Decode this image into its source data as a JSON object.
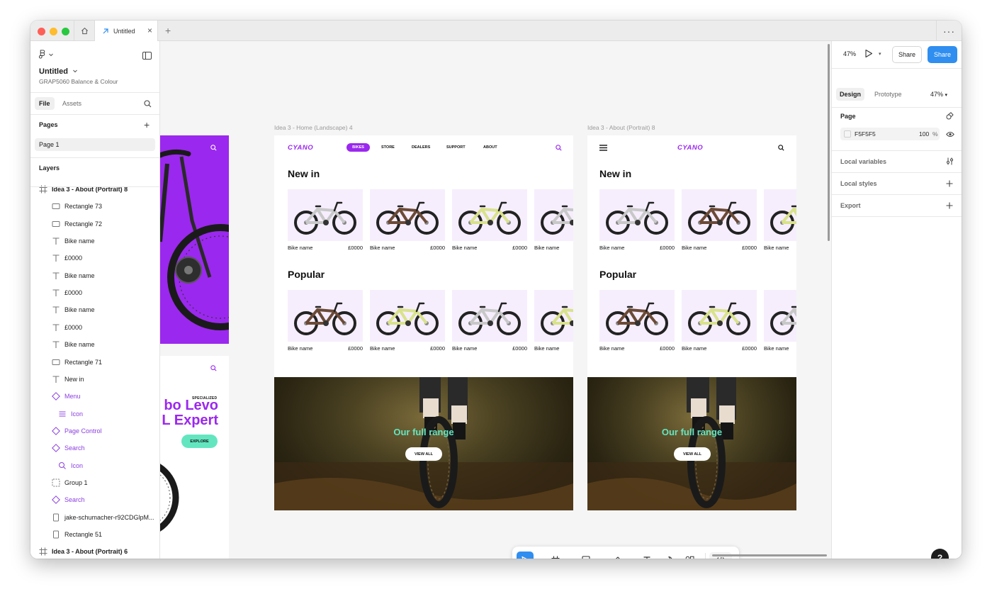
{
  "titlebar": {
    "tab_title": "Untitled",
    "close_glyph": "×",
    "add_glyph": "+",
    "more_glyph": "···"
  },
  "left_panel": {
    "file_name": "Untitled",
    "project_name": "GRAP5060 Balance & Colour",
    "file_tabs": [
      "File",
      "Assets"
    ],
    "pages_title": "Pages",
    "pages_add": "+",
    "pages": [
      "Page 1"
    ],
    "layers_title": "Layers",
    "layers": [
      {
        "label": "Idea 3 - About (Portrait) 8",
        "icon": "frame-icon",
        "indent": 0,
        "color": "normal",
        "bold": true
      },
      {
        "label": "Rectangle 73",
        "icon": "rectangle-icon",
        "indent": 2,
        "color": "normal",
        "bold": false
      },
      {
        "label": "Rectangle 72",
        "icon": "rectangle-icon",
        "indent": 2,
        "color": "normal",
        "bold": false
      },
      {
        "label": "Bike name",
        "icon": "text-icon",
        "indent": 2,
        "color": "normal",
        "bold": false
      },
      {
        "label": "£0000",
        "icon": "text-icon",
        "indent": 2,
        "color": "normal",
        "bold": false
      },
      {
        "label": "Bike name",
        "icon": "text-icon",
        "indent": 2,
        "color": "normal",
        "bold": false
      },
      {
        "label": "£0000",
        "icon": "text-icon",
        "indent": 2,
        "color": "normal",
        "bold": false
      },
      {
        "label": "Bike name",
        "icon": "text-icon",
        "indent": 2,
        "color": "normal",
        "bold": false
      },
      {
        "label": "£0000",
        "icon": "text-icon",
        "indent": 2,
        "color": "normal",
        "bold": false
      },
      {
        "label": "Bike name",
        "icon": "text-icon",
        "indent": 2,
        "color": "normal",
        "bold": false
      },
      {
        "label": "Rectangle 71",
        "icon": "rectangle-icon",
        "indent": 2,
        "color": "normal",
        "bold": false
      },
      {
        "label": "New in",
        "icon": "text-icon",
        "indent": 2,
        "color": "normal",
        "bold": false
      },
      {
        "label": "Menu",
        "icon": "component-icon",
        "indent": 2,
        "color": "purple",
        "bold": false
      },
      {
        "label": "Icon",
        "icon": "list-icon",
        "indent": 3,
        "color": "purple",
        "bold": false
      },
      {
        "label": "Page Control",
        "icon": "component-icon",
        "indent": 2,
        "color": "purple",
        "bold": false
      },
      {
        "label": "Search",
        "icon": "component-icon",
        "indent": 2,
        "color": "purple",
        "bold": false
      },
      {
        "label": "Icon",
        "icon": "search-icon",
        "indent": 3,
        "color": "purple",
        "bold": false
      },
      {
        "label": "Group 1",
        "icon": "group-icon",
        "indent": 2,
        "color": "normal",
        "bold": false
      },
      {
        "label": "Search",
        "icon": "component-icon",
        "indent": 2,
        "color": "purple",
        "bold": false
      },
      {
        "label": "jake-schumacher-r92CDGlpM...",
        "icon": "image-icon",
        "indent": 2,
        "color": "normal",
        "bold": false
      },
      {
        "label": "Rectangle 51",
        "icon": "image-icon",
        "indent": 2,
        "color": "normal",
        "bold": false
      },
      {
        "label": "Idea 3 - About (Portrait) 6",
        "icon": "frame-icon",
        "indent": 0,
        "color": "normal",
        "bold": true
      }
    ]
  },
  "canvas": {
    "partial_frame": {
      "brand": "SPECIALIZED",
      "headline_line1": "bo Levo",
      "headline_line2": "L Expert",
      "cta": "EXPLORE"
    },
    "frame_landscape": {
      "label": "Idea 3 - Home (Landscape) 4",
      "logo": "CYANO",
      "nav": [
        "BIKES",
        "STORE",
        "DEALERS",
        "SUPPORT",
        "ABOUT"
      ],
      "new_in_title": "New in",
      "popular_title": "Popular",
      "new_in": [
        {
          "name": "Bike name",
          "price": "£0000",
          "color": "#c8c8c8"
        },
        {
          "name": "Bike name",
          "price": "£0000",
          "color": "#6b4a36"
        },
        {
          "name": "Bike name",
          "price": "£0000",
          "color": "#d9e28a"
        },
        {
          "name": "Bike name",
          "price": "",
          "color": "#c8c8c8"
        }
      ],
      "popular": [
        {
          "name": "Bike name",
          "price": "£0000",
          "color": "#6b4a36"
        },
        {
          "name": "Bike name",
          "price": "£0000",
          "color": "#d9e28a"
        },
        {
          "name": "Bike name",
          "price": "£0000",
          "color": "#c8c8c8"
        },
        {
          "name": "Bike name",
          "price": "",
          "color": "#d9e28a"
        }
      ],
      "hero_title": "Our full range",
      "hero_cta": "VIEW ALL"
    },
    "frame_portrait": {
      "label": "Idea 3 - About (Portrait) 8",
      "logo": "CYANO",
      "new_in_title": "New in",
      "popular_title": "Popular",
      "new_in": [
        {
          "name": "Bike name",
          "price": "£0000",
          "color": "#c8c8c8"
        },
        {
          "name": "Bike name",
          "price": "£0000",
          "color": "#6b4a36"
        },
        {
          "name": "Bike name",
          "price": "",
          "color": "#d9e28a"
        }
      ],
      "popular": [
        {
          "name": "Bike name",
          "price": "£0000",
          "color": "#6b4a36"
        },
        {
          "name": "Bike name",
          "price": "£0000",
          "color": "#d9e28a"
        },
        {
          "name": "Bike name",
          "price": "",
          "color": "#c8c8c8"
        }
      ],
      "hero_title": "Our full range",
      "hero_cta": "VIEW ALL"
    }
  },
  "right_panel": {
    "zoom": "47%",
    "share_outline": "Share",
    "share_primary": "Share",
    "tabs": [
      "Design",
      "Prototype"
    ],
    "tab_zoom": "47%",
    "page_section": "Page",
    "fill_hex": "F5F5F5",
    "fill_opacity": "100",
    "fill_pct": "%",
    "local_variables": "Local variables",
    "local_styles": "Local styles",
    "export": "Export",
    "help": "?"
  },
  "colors": {
    "accent_purple": "#9b28ee",
    "accent_mint": "#63e6c0",
    "primary_blue": "#2f8ef0"
  }
}
